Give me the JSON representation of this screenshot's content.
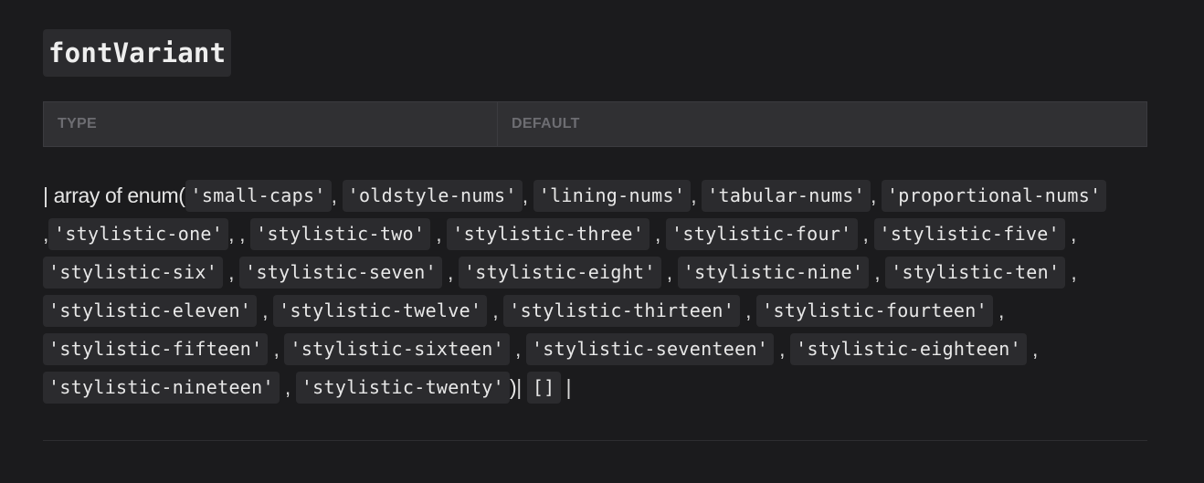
{
  "prop": {
    "name": "fontVariant"
  },
  "table": {
    "headers": [
      "TYPE",
      "DEFAULT"
    ]
  },
  "type_description": {
    "prefix": "| array of enum(",
    "values": [
      "'small-caps'",
      "'oldstyle-nums'",
      "'lining-nums'",
      "'tabular-nums'",
      "'proportional-nums'",
      "'stylistic-one'",
      "'stylistic-two'",
      "'stylistic-three'",
      "'stylistic-four'",
      "'stylistic-five'",
      "'stylistic-six'",
      "'stylistic-seven'",
      "'stylistic-eight'",
      "'stylistic-nine'",
      "'stylistic-ten'",
      "'stylistic-eleven'",
      "'stylistic-twelve'",
      "'stylistic-thirteen'",
      "'stylistic-fourteen'",
      "'stylistic-fifteen'",
      "'stylistic-sixteen'",
      "'stylistic-seventeen'",
      "'stylistic-eighteen'",
      "'stylistic-nineteen'",
      "'stylistic-twenty'"
    ],
    "separator": ",",
    "double_separator": ", ,",
    "close_paren": ")",
    "pipe": "|",
    "default_value": "[]"
  }
}
